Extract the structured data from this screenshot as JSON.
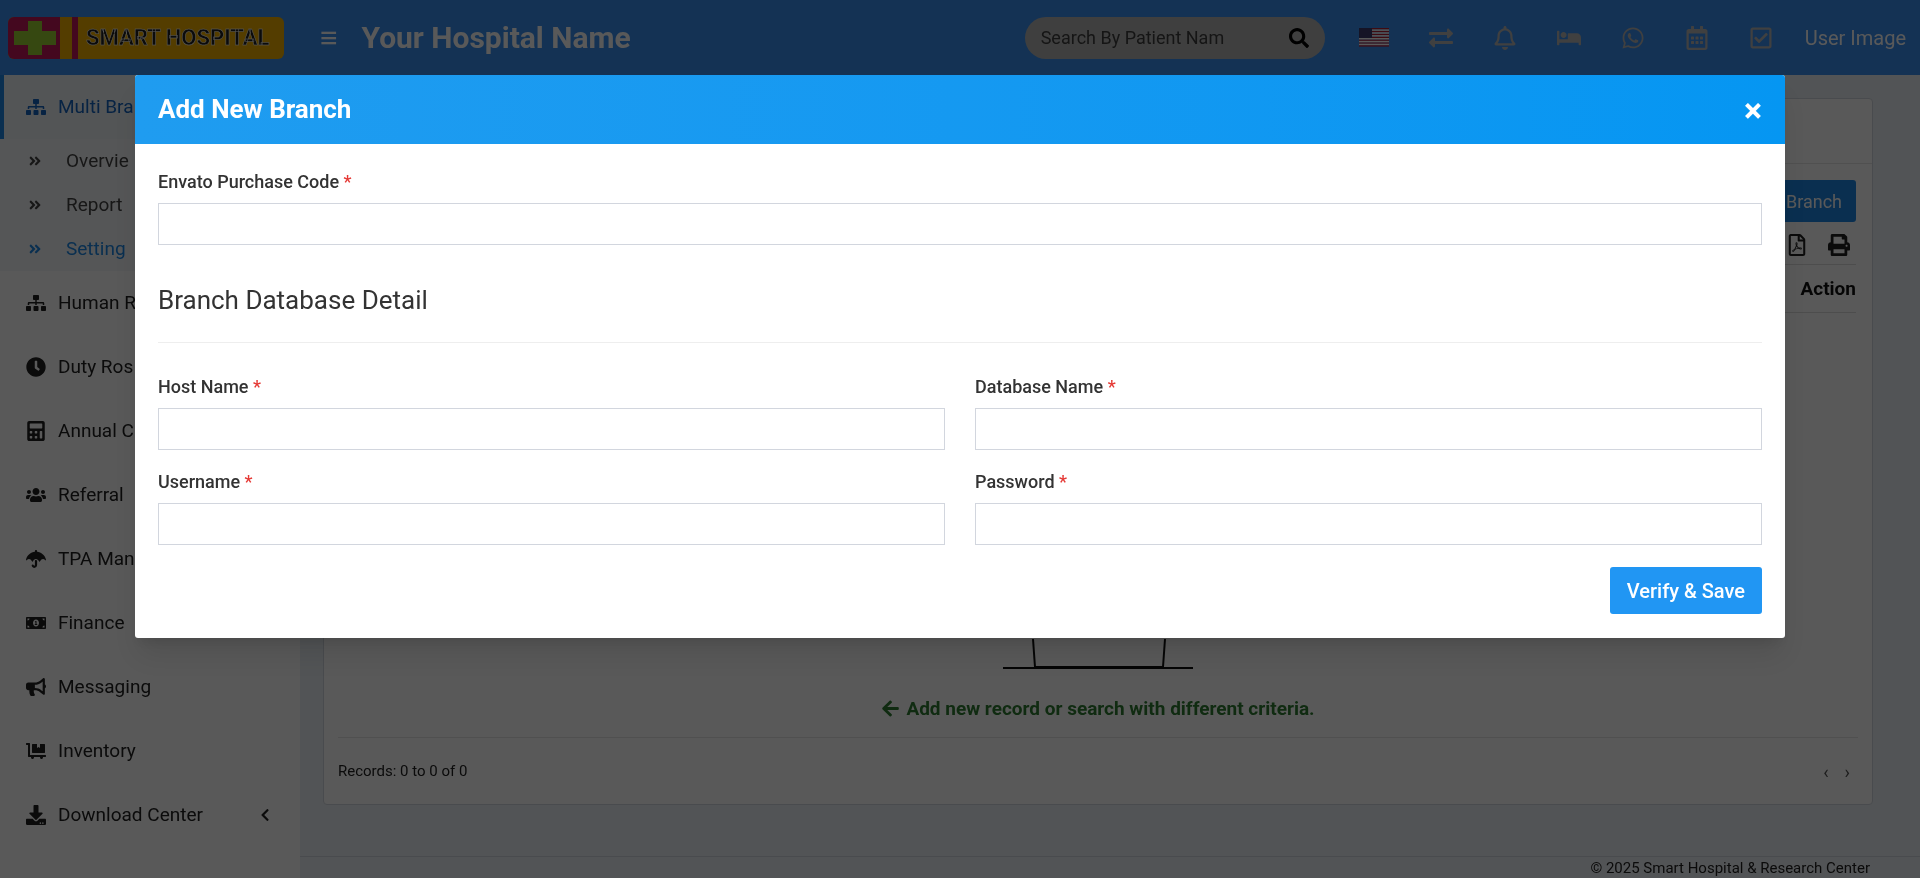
{
  "header": {
    "logo": "SMART HOSPITAL",
    "menu_icon": "≡",
    "hospital_name": "Your Hospital Name",
    "search": {
      "placeholder": "Search By Patient Nam"
    },
    "user_image": "User Image"
  },
  "sidebar": {
    "items": [
      {
        "label": "Multi Bra",
        "selected": true,
        "expanded": true,
        "children": [
          {
            "label": "Overvie",
            "selected": false
          },
          {
            "label": "Report",
            "selected": false
          },
          {
            "label": "Setting",
            "selected": true
          }
        ]
      },
      {
        "label": "Human R",
        "selected": false
      },
      {
        "label": "Duty Ros",
        "selected": false
      },
      {
        "label": "Annual C",
        "selected": false
      },
      {
        "label": "Referral",
        "selected": false
      },
      {
        "label": "TPA Man",
        "selected": false
      },
      {
        "label": "Finance",
        "selected": false
      },
      {
        "label": "Messaging",
        "selected": false
      },
      {
        "label": "Inventory",
        "selected": false
      },
      {
        "label": "Download Center",
        "selected": false,
        "chevron": true
      }
    ]
  },
  "background": {
    "add_button": "Branch",
    "column_header": "Action",
    "empty_message": "Add new record or search with different criteria.",
    "records": "Records: 0 to 0 of 0",
    "pager": [
      "‹",
      "›"
    ],
    "footer": "© 2025 Smart Hospital & Research Center"
  },
  "modal": {
    "title": "Add New Branch",
    "close": "×",
    "purchase_code": {
      "label": "Envato Purchase Code",
      "required": "*"
    },
    "section_title": "Branch Database Detail",
    "fields": [
      {
        "label": "Host Name",
        "required": "*"
      },
      {
        "label": "Database Name",
        "required": "*"
      },
      {
        "label": "Username",
        "required": "*"
      },
      {
        "label": "Password",
        "required": "*"
      }
    ],
    "submit": "Verify & Save"
  }
}
